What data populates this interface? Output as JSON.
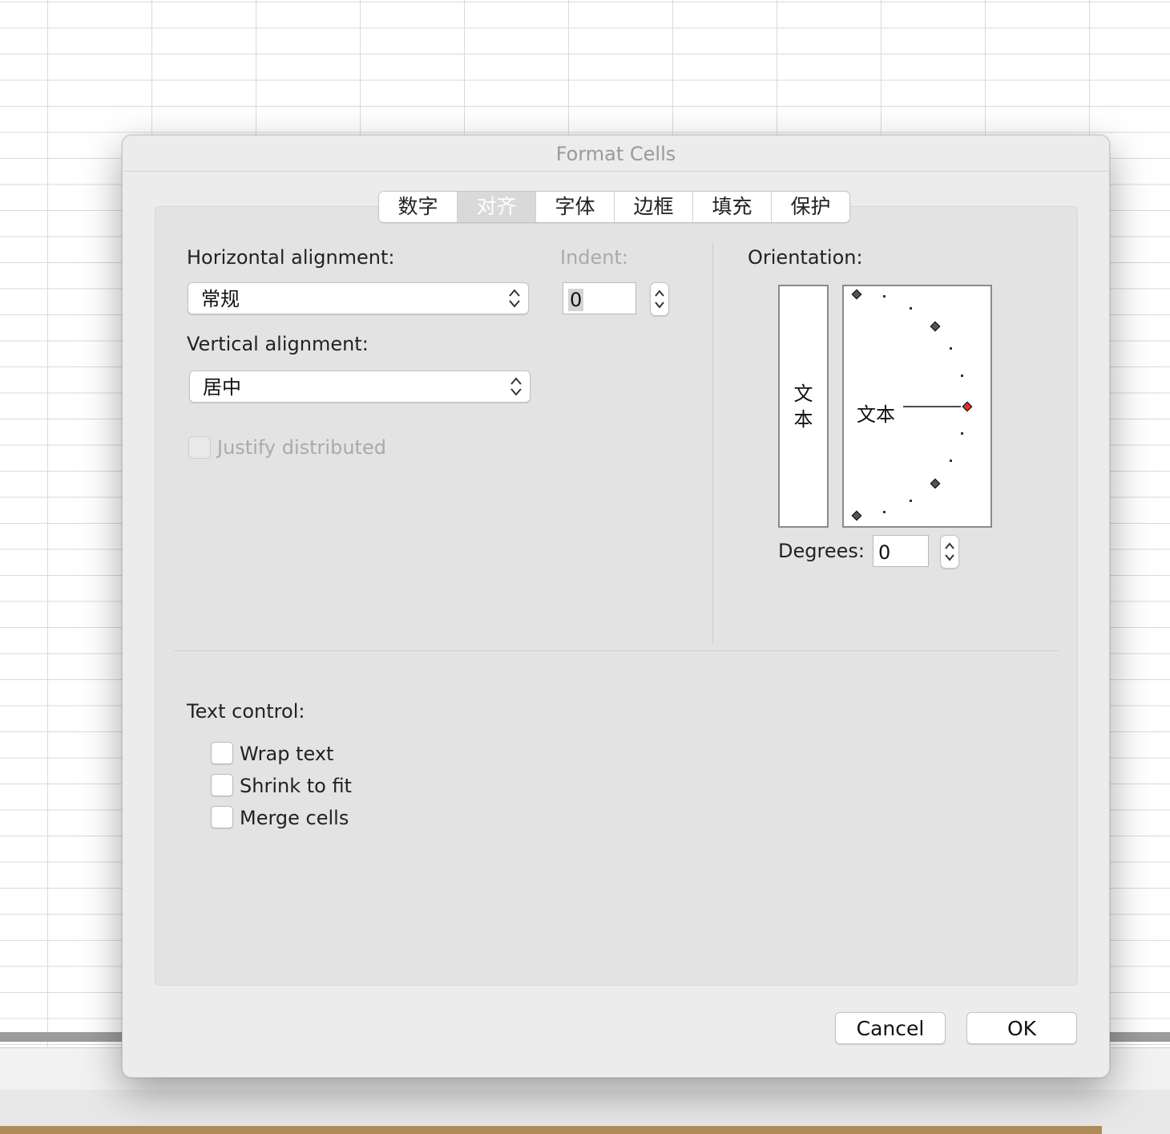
{
  "dialog": {
    "title": "Format Cells",
    "tabs": [
      {
        "label": "数字"
      },
      {
        "label": "对齐",
        "active": true
      },
      {
        "label": "字体"
      },
      {
        "label": "边框"
      },
      {
        "label": "填充"
      },
      {
        "label": "保护"
      }
    ],
    "horizontal": {
      "label": "Horizontal alignment:",
      "value": "常规"
    },
    "indent": {
      "label": "Indent:",
      "value": "0"
    },
    "vertical": {
      "label": "Vertical alignment:",
      "value": "居中"
    },
    "justify": {
      "label": "Justify distributed",
      "checked": false,
      "enabled": false
    },
    "orientation": {
      "label": "Orientation:",
      "vertical_text_top": "文",
      "vertical_text_bottom": "本",
      "horizontal_text": "文本",
      "degrees_label": "Degrees:",
      "degrees_value": "0",
      "selected_color": "#e03030"
    },
    "text_control": {
      "label": "Text control:",
      "options": [
        {
          "label": "Wrap text",
          "checked": false
        },
        {
          "label": "Shrink to fit",
          "checked": false
        },
        {
          "label": "Merge cells",
          "checked": false
        }
      ]
    },
    "buttons": {
      "cancel": "Cancel",
      "ok": "OK"
    }
  }
}
